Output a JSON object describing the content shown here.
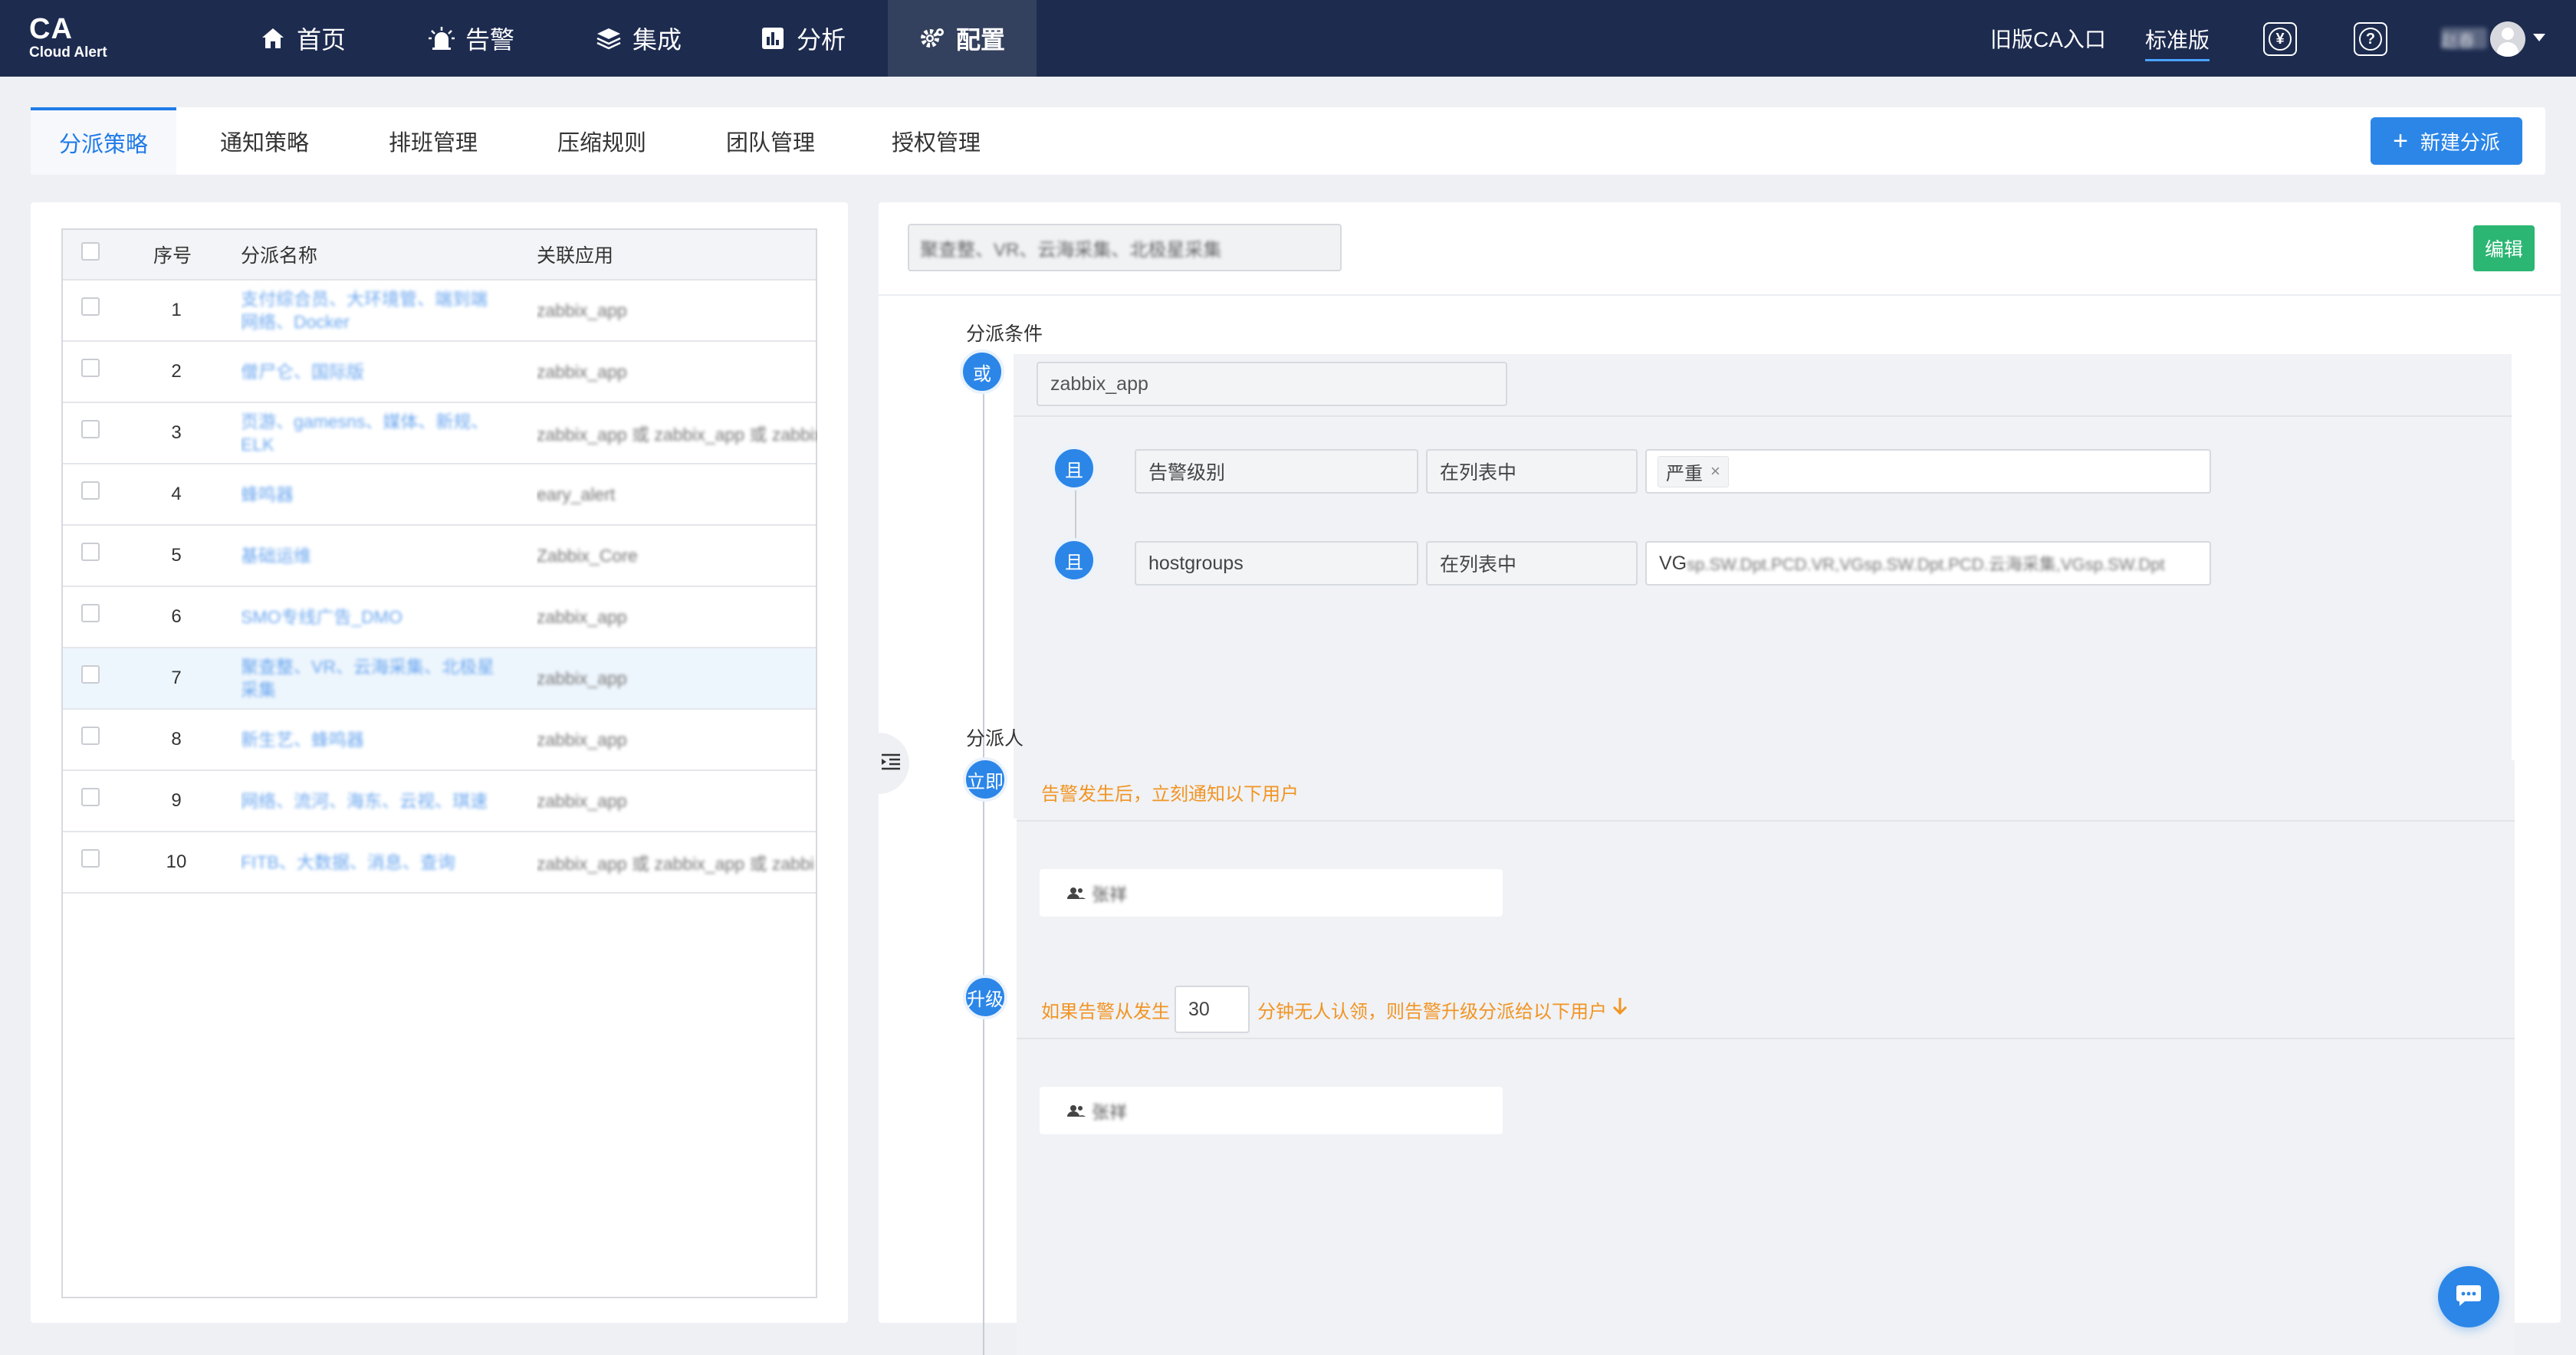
{
  "brand": {
    "name": "CA",
    "subtitle": "Cloud Alert"
  },
  "nav": {
    "items": [
      {
        "label": "首页",
        "icon": "home-icon"
      },
      {
        "label": "告警",
        "icon": "alarm-light-icon"
      },
      {
        "label": "集成",
        "icon": "layers-icon"
      },
      {
        "label": "分析",
        "icon": "bar-chart-icon"
      },
      {
        "label": "配置",
        "icon": "gear-icon",
        "active": true
      }
    ],
    "legacy_entry": "旧版CA入口",
    "edition": "标准版",
    "billing_icon": "yen-icon",
    "help_icon": "help-icon",
    "username": "赵春"
  },
  "subtabs": {
    "items": [
      "分派策略",
      "通知策略",
      "排班管理",
      "压缩规则",
      "团队管理",
      "授权管理"
    ],
    "active_index": 0,
    "new_button": "新建分派"
  },
  "table": {
    "headers": {
      "index": "序号",
      "name": "分派名称",
      "app": "关联应用"
    },
    "rows": [
      {
        "index": "1",
        "name": "支付综合员、大环境管、端到端网络、Docker",
        "app": "zabbix_app"
      },
      {
        "index": "2",
        "name": "僧尸仑、国际版",
        "app": "zabbix_app"
      },
      {
        "index": "3",
        "name": "页游、gamesns、媒体、新规、ELK",
        "app": "zabbix_app 或 zabbix_app 或 zabbix"
      },
      {
        "index": "4",
        "name": "蜂鸣器",
        "app": "eary_alert"
      },
      {
        "index": "5",
        "name": "基础运维",
        "app": "Zabbix_Core"
      },
      {
        "index": "6",
        "name": "SMO专线广告_DMO",
        "app": "zabbix_app"
      },
      {
        "index": "7",
        "name": "聚查整、VR、云海采集、北极星采集",
        "app": "zabbix_app",
        "selected": true
      },
      {
        "index": "8",
        "name": "新生艺、蜂鸣器",
        "app": "zabbix_app"
      },
      {
        "index": "9",
        "name": "网络、流河、海东、云视、琪速",
        "app": "zabbix_app"
      },
      {
        "index": "10",
        "name": "FITB、大数据、消息、查询",
        "app": "zabbix_app 或 zabbix_app 或 zabbi"
      }
    ]
  },
  "detail": {
    "policy_name": "聚查整、VR、云海采集、北极星采集",
    "edit_button": "编辑",
    "conditions_title": "分派条件",
    "or_badge": "或",
    "app_value": "zabbix_app",
    "and_badge": "且",
    "rules": [
      {
        "field": "告警级别",
        "operator": "在列表中",
        "tag": "严重",
        "remove": "×"
      },
      {
        "field": "hostgroups",
        "operator": "在列表中",
        "value_prefix": "VG",
        "value_rest": "sp.SW.Dpt.PCD.VR,VGsp.SW.Dpt.PCD.云海采集,VGsp.SW.Dpt"
      }
    ],
    "assignee_title": "分派人",
    "immediate_badge": "立即",
    "immediate_text": "告警发生后，立刻通知以下用户",
    "immediate_user": "张祥",
    "escalate_badge": "升级",
    "escalate_prefix": "如果告警从发生",
    "escalate_minutes": "30",
    "escalate_suffix": "分钟无人认领，则告警升级分派给以下用户",
    "escalate_user": "张祥"
  },
  "colors": {
    "nav_bg": "#1d2b4f",
    "primary": "#2b86e8",
    "success": "#2bb673",
    "warning": "#f29423"
  }
}
